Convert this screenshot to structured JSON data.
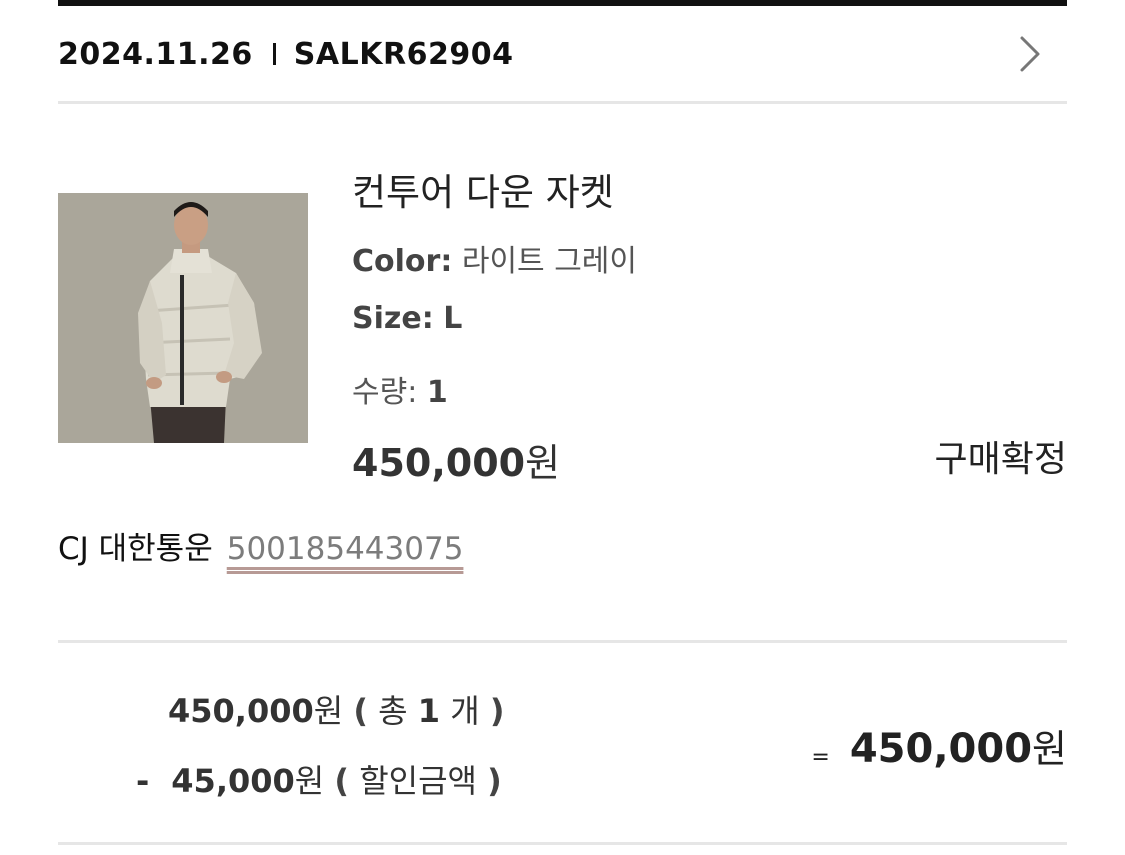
{
  "order": {
    "date": "2024.11.26",
    "separator": "I",
    "id": "SALKR62904",
    "detail_icon": "chevron-right-icon"
  },
  "product": {
    "name": "컨투어 다운 자켓",
    "image_icon": "product-photo",
    "color_label": "Color:",
    "color_value": "라이트 그레이",
    "size_label": "Size:",
    "size_value": "L",
    "qty_label": "수량:",
    "qty_value": "1",
    "price_number": "450,000",
    "price_unit": "원",
    "status": "구매확정"
  },
  "shipping": {
    "courier": "CJ 대한통운",
    "tracking_number": "500185443075"
  },
  "summary": {
    "subtotal_number": "450,000",
    "subtotal_unit": "원",
    "subtotal_note_open": "(",
    "subtotal_note_prefix": "총",
    "subtotal_count": "1",
    "subtotal_count_unit": "개",
    "subtotal_note_close": ")",
    "discount_sign": "-",
    "discount_number": "45,000",
    "discount_unit": "원",
    "discount_note_open": "(",
    "discount_label": "할인금액",
    "discount_note_close": ")",
    "equals": "=",
    "total_number": "450,000",
    "total_unit": "원"
  },
  "colors": {
    "rule_dark": "#111111",
    "rule_light": "#e6e6e6",
    "image_bg": "#a9a599",
    "tracking_text": "#7c7c7c",
    "tracking_underline": "#b79a95"
  }
}
